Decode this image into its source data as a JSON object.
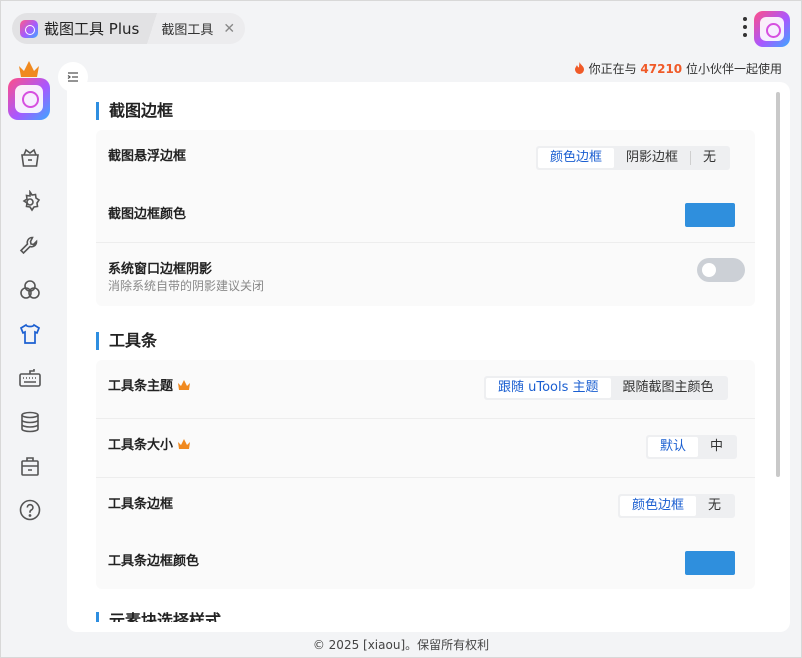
{
  "tabs": {
    "main_label": "截图工具 Plus",
    "sub_label": "截图工具",
    "close_symbol": "✕"
  },
  "header": {
    "users_prefix": "你正在与",
    "users_count": "47210",
    "users_suffix": "位小伙伴一起使用"
  },
  "sidebar": {
    "items": [
      {
        "icon": "package-icon"
      },
      {
        "icon": "gear-icon"
      },
      {
        "icon": "wrench-icon"
      },
      {
        "icon": "circles-icon"
      },
      {
        "icon": "shirt-icon",
        "active": true
      },
      {
        "icon": "keyboard-icon"
      },
      {
        "icon": "database-icon"
      },
      {
        "icon": "store-icon"
      },
      {
        "icon": "help-icon"
      }
    ]
  },
  "sections": {
    "border": {
      "title": "截图边框",
      "floating_label": "截图悬浮边框",
      "floating_options": [
        "颜色边框",
        "阴影边框",
        "无"
      ],
      "floating_selected": "颜色边框",
      "color_label": "截图边框颜色",
      "color_value": "#2f8fdd",
      "shadow_label": "系统窗口边框阴影",
      "shadow_desc": "消除系统自带的阴影建议关闭",
      "shadow_enabled": false
    },
    "toolbar": {
      "title": "工具条",
      "theme_label": "工具条主题",
      "theme_options": [
        "跟随 uTools 主题",
        "跟随截图主颜色"
      ],
      "theme_selected": "跟随 uTools 主题",
      "size_label": "工具条大小",
      "size_options": [
        "默认",
        "中"
      ],
      "size_selected": "默认",
      "border_label": "工具条边框",
      "border_options": [
        "颜色边框",
        "无"
      ],
      "border_selected": "颜色边框",
      "border_color_label": "工具条边框颜色",
      "border_color_value": "#2f8fdd"
    },
    "next_title_partial": "元素块选择样式"
  },
  "footer": {
    "text": "© 2025 [xiaou]。保留所有权利"
  },
  "colors": {
    "accent": "#2f8fdd",
    "active_text": "#1b5fd1",
    "count_highlight": "#f05a28",
    "crown": "#f0891f"
  }
}
